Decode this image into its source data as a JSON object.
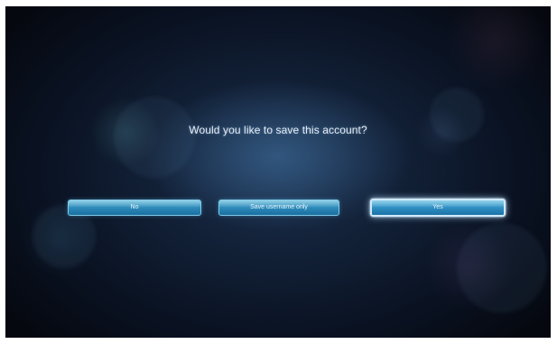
{
  "dialog": {
    "question": "Would you like to save this account?",
    "buttons": {
      "no": "No",
      "username_only": "Save username only",
      "yes": "Yes"
    },
    "focused_button": "yes"
  }
}
